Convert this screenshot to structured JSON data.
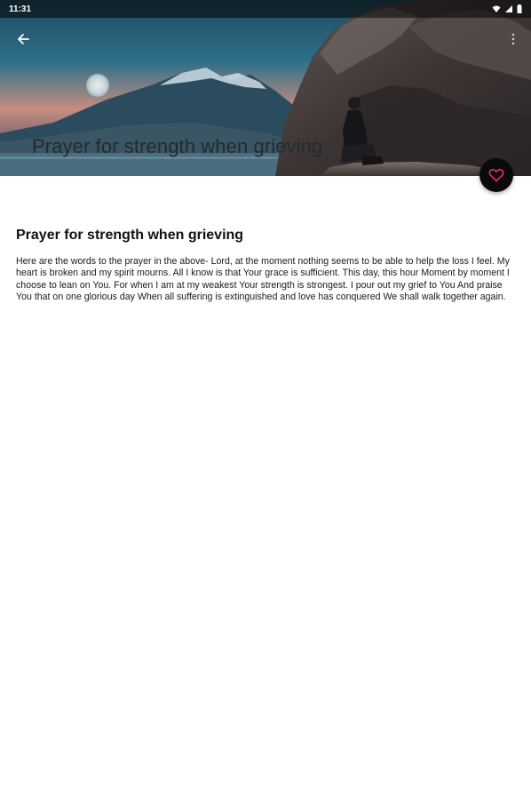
{
  "status_bar": {
    "time": "11:31"
  },
  "toolbar": {
    "back_icon": "arrow-back-icon",
    "more_icon": "more-vert-icon",
    "title": "Prayer for strength when grieving"
  },
  "fab": {
    "icon": "heart-outline-icon",
    "icon_color": "#e0334d"
  },
  "article": {
    "title": "Prayer for strength when grieving",
    "body": "Here are the words to the prayer in the above- Lord, at the moment nothing seems to be able to help the loss I feel. My heart is broken and my spirit mourns. All I know is that Your grace is sufficient. This day, this hour Moment by moment I choose to lean on You. For when I am at my weakest Your strength is strongest. I pour out my grief to You And praise You that on one glorious day When all suffering is extinguished and love has conquered We shall walk together again."
  }
}
